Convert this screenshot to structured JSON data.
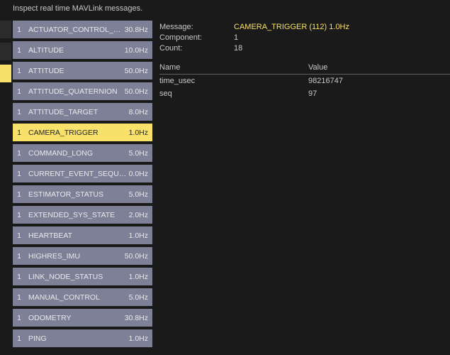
{
  "header": "Inspect real time MAVLink messages.",
  "selected_index": 5,
  "messages": [
    {
      "comp": "1",
      "name": "ACTUATOR_CONTROL_TARGET",
      "hz": "30.8Hz"
    },
    {
      "comp": "1",
      "name": "ALTITUDE",
      "hz": "10.0Hz"
    },
    {
      "comp": "1",
      "name": "ATTITUDE",
      "hz": "50.0Hz"
    },
    {
      "comp": "1",
      "name": "ATTITUDE_QUATERNION",
      "hz": "50.0Hz"
    },
    {
      "comp": "1",
      "name": "ATTITUDE_TARGET",
      "hz": "8.0Hz"
    },
    {
      "comp": "1",
      "name": "CAMERA_TRIGGER",
      "hz": "1.0Hz"
    },
    {
      "comp": "1",
      "name": "COMMAND_LONG",
      "hz": "5.0Hz"
    },
    {
      "comp": "1",
      "name": "CURRENT_EVENT_SEQUENCE",
      "hz": "0.0Hz"
    },
    {
      "comp": "1",
      "name": "ESTIMATOR_STATUS",
      "hz": "5.0Hz"
    },
    {
      "comp": "1",
      "name": "EXTENDED_SYS_STATE",
      "hz": "2.0Hz"
    },
    {
      "comp": "1",
      "name": "HEARTBEAT",
      "hz": "1.0Hz"
    },
    {
      "comp": "1",
      "name": "HIGHRES_IMU",
      "hz": "50.0Hz"
    },
    {
      "comp": "1",
      "name": "LINK_NODE_STATUS",
      "hz": "1.0Hz"
    },
    {
      "comp": "1",
      "name": "MANUAL_CONTROL",
      "hz": "5.0Hz"
    },
    {
      "comp": "1",
      "name": "ODOMETRY",
      "hz": "30.8Hz"
    },
    {
      "comp": "1",
      "name": "PING",
      "hz": "1.0Hz"
    }
  ],
  "detail": {
    "labels": {
      "message": "Message:",
      "component": "Component:",
      "count": "Count:"
    },
    "message": "CAMERA_TRIGGER (112) 1.0Hz",
    "component": "1",
    "count": "18",
    "columns": {
      "name": "Name",
      "value": "Value"
    },
    "fields": [
      {
        "name": "time_usec",
        "value": "98216747"
      },
      {
        "name": "seq",
        "value": "97"
      }
    ]
  },
  "gutter_bars": 3,
  "gutter_active_index": 2
}
